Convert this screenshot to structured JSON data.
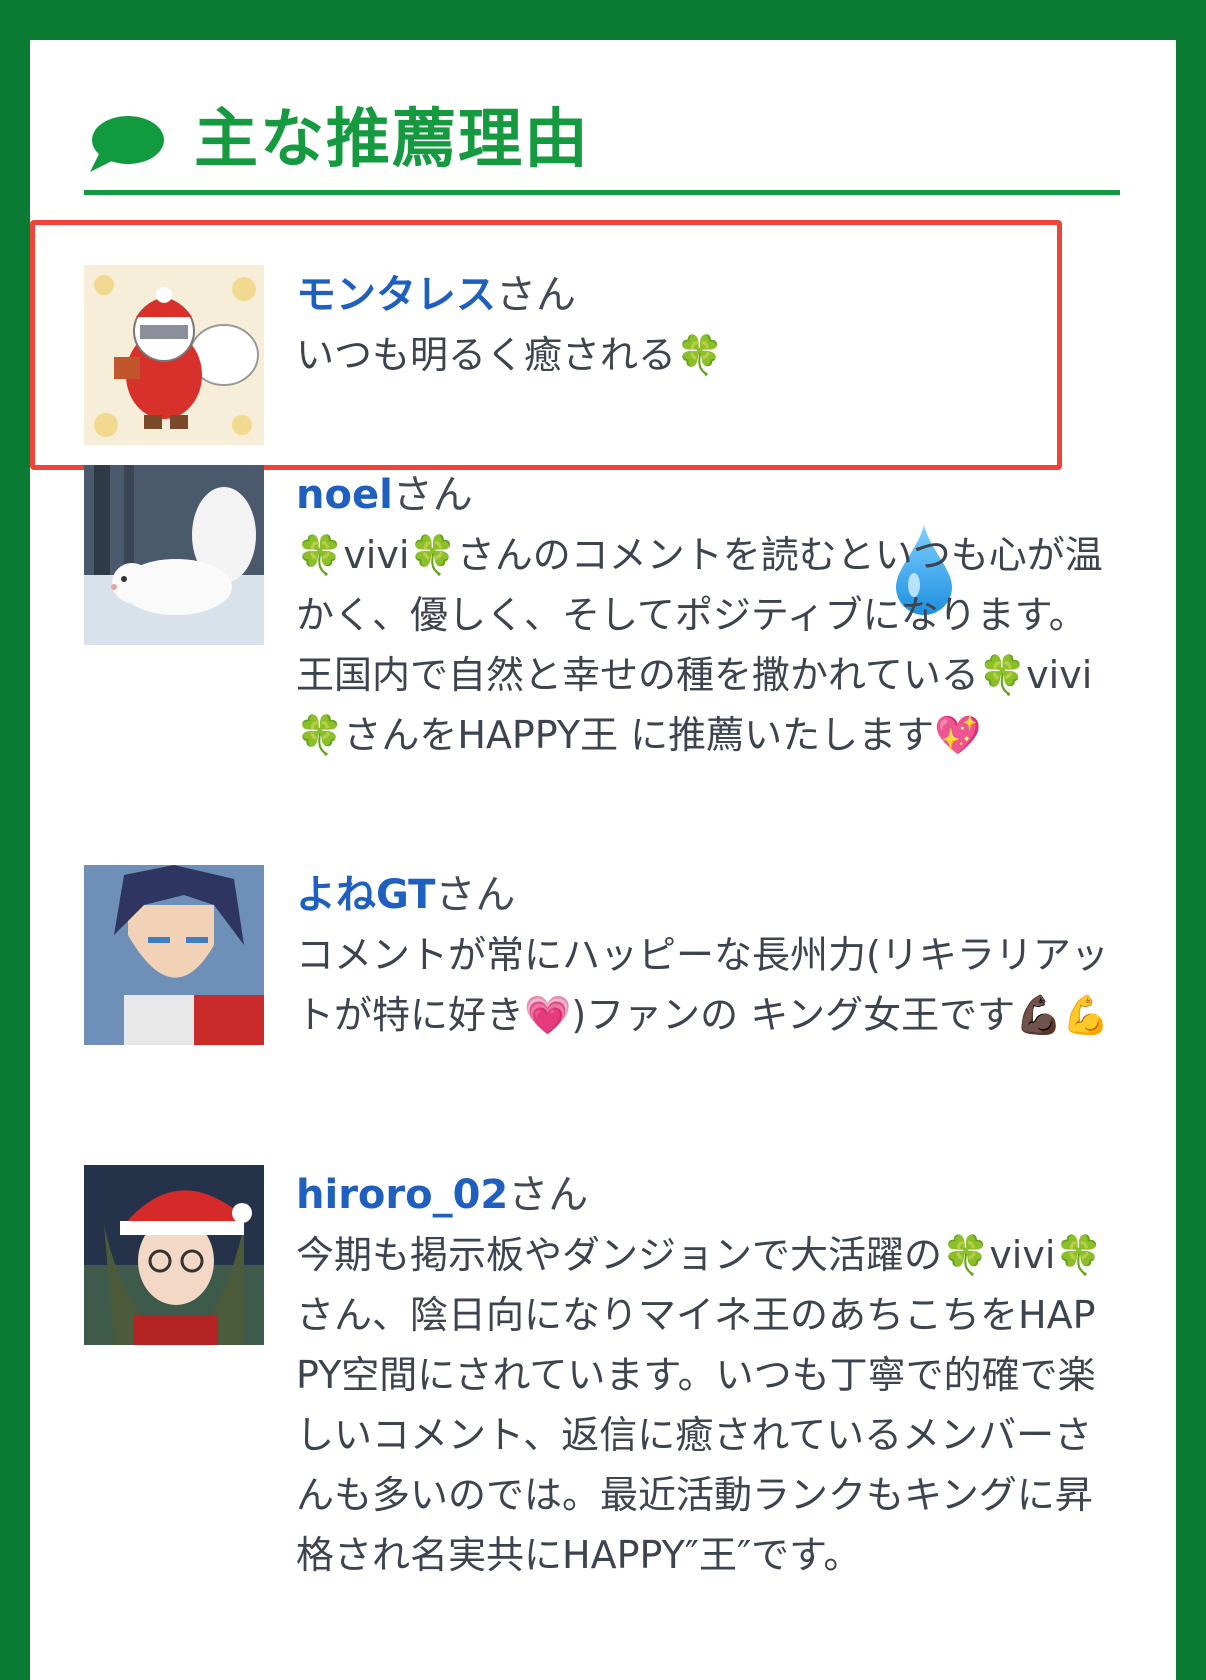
{
  "section": {
    "title": "主な推薦理由",
    "icon": "speech-bubble-icon",
    "accent_color": "#169a3f"
  },
  "honorific": "さん",
  "entries": [
    {
      "name": "モンタレス",
      "comment": "いつも明るく癒される🍀",
      "avatar": "santa-cat-avatar",
      "highlighted": true,
      "extra_icon": "droplet-icon"
    },
    {
      "name": "noel",
      "comment": "🍀vivi🍀さんのコメントを読むといつも心が温かく、優しく、そしてポジティブになります。 王国内で自然と幸せの種を撒かれている🍀vivi🍀さんをHAPPY王 に推薦いたします💖",
      "avatar": "white-squirrel-avatar"
    },
    {
      "name": "よねGT",
      "comment": "コメントが常にハッピーな長州力(リキラリアットが特に好き💗)ファンの キング女王です💪🏿💪",
      "avatar": "anime-man-avatar"
    },
    {
      "name": "hiroro_02",
      "comment": "今期も掲示板やダンジョンで大活躍の🍀vivi🍀さん、陰日向になりマイネ王のあちこちをHAPPY空間にされています。いつも丁寧で的確で楽しいコメント、返信に癒されているメンバーさんも多いのでは。最近活動ランクもキングに昇格され名実共にHAPPY″王″です。",
      "avatar": "santa-hat-girl-avatar"
    }
  ],
  "colors": {
    "outer_border": "#0b7a33",
    "name_link": "#1f5fbf",
    "highlight_border": "#f0443b"
  }
}
